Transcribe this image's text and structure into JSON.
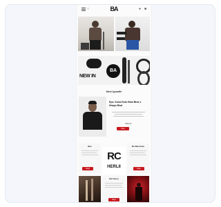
{
  "header": {
    "logo": "BA",
    "icons": [
      "menu-icon",
      "search-icon",
      "account-icon",
      "cart-icon"
    ]
  },
  "banner": {
    "text": "NEW IN",
    "badge": "BA"
  },
  "section": {
    "title": "Meet Aymaffe"
  },
  "ambassador": {
    "name": "Eps: Kuba Ruto Bhai Bhai x Hhaps Bhai",
    "label": "Mentor",
    "button": "Shop"
  },
  "cards": {
    "left_title": "Bee",
    "right_title": "Be Bae Ence",
    "left_button": "Shop",
    "right_button": "Shop",
    "lower_title": "Del lunoy",
    "lower_button": "Shop"
  },
  "rc_block": {
    "mark": "RC",
    "sub": "HERLII"
  },
  "colors": {
    "accent": "#c8191f",
    "frame_bg": "#f4f6fb",
    "page_bg": "#fbfbfb"
  }
}
